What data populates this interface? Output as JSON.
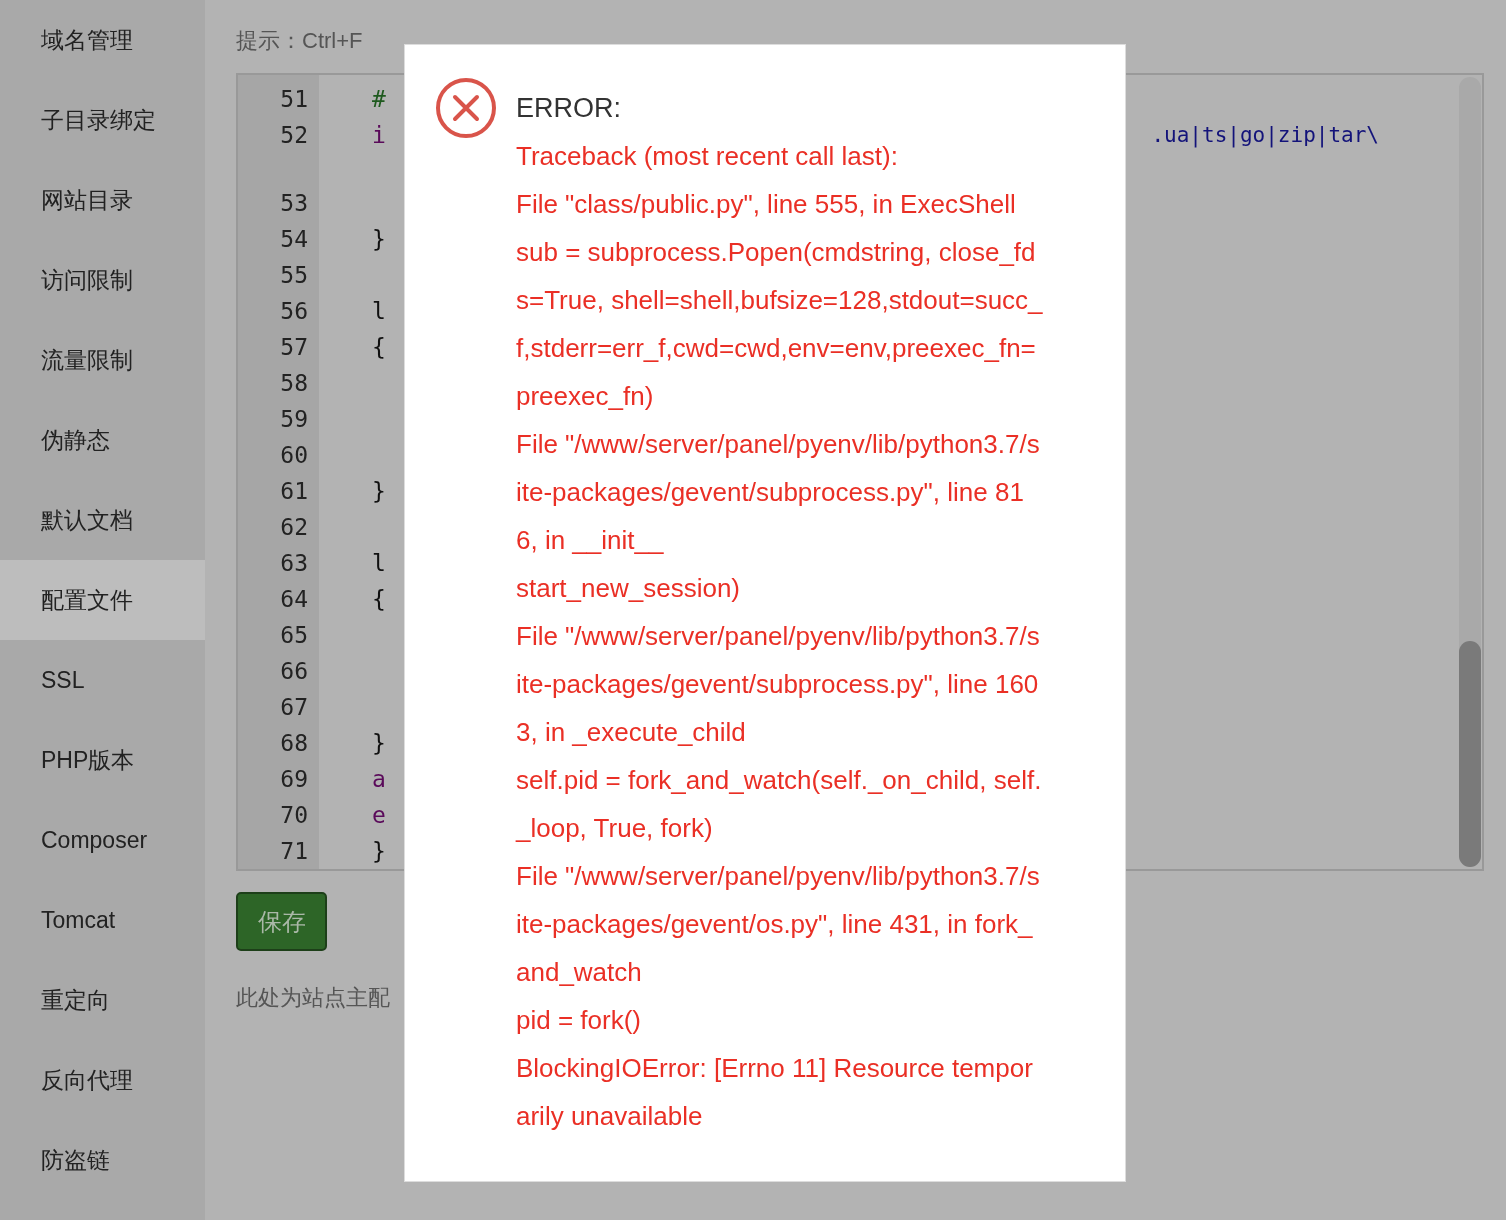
{
  "sidebar": {
    "items": [
      {
        "label": "域名管理",
        "selected": false
      },
      {
        "label": "子目录绑定",
        "selected": false
      },
      {
        "label": "网站目录",
        "selected": false
      },
      {
        "label": "访问限制",
        "selected": false
      },
      {
        "label": "流量限制",
        "selected": false
      },
      {
        "label": "伪静态",
        "selected": false
      },
      {
        "label": "默认文档",
        "selected": false
      },
      {
        "label": "配置文件",
        "selected": true
      },
      {
        "label": "SSL",
        "selected": false
      },
      {
        "label": "PHP版本",
        "selected": false
      },
      {
        "label": "Composer",
        "selected": false
      },
      {
        "label": "Tomcat",
        "selected": false
      },
      {
        "label": "重定向",
        "selected": false
      },
      {
        "label": "反向代理",
        "selected": false
      },
      {
        "label": "防盗链",
        "selected": false
      }
    ]
  },
  "hint": "提示：Ctrl+F",
  "editor": {
    "lines": [
      {
        "number": "51",
        "code": "#",
        "kind": "comment",
        "wrapped": false
      },
      {
        "number": "52",
        "code": "i",
        "kind": "keyword",
        "tail": ".ua|ts|go|zip|tar\\",
        "wrapped": true
      },
      {
        "number": "53",
        "wrapped": false
      },
      {
        "number": "54",
        "code": "}",
        "kind": "plain",
        "wrapped": false
      },
      {
        "number": "55",
        "wrapped": false
      },
      {
        "number": "56",
        "code": "l",
        "kind": "plain",
        "wrapped": false
      },
      {
        "number": "57",
        "code": "{",
        "kind": "plain",
        "wrapped": false
      },
      {
        "number": "58",
        "wrapped": false
      },
      {
        "number": "59",
        "wrapped": false
      },
      {
        "number": "60",
        "wrapped": false
      },
      {
        "number": "61",
        "code": "}",
        "kind": "plain",
        "wrapped": false
      },
      {
        "number": "62",
        "wrapped": false
      },
      {
        "number": "63",
        "code": "l",
        "kind": "plain",
        "wrapped": false
      },
      {
        "number": "64",
        "code": "{",
        "kind": "plain",
        "wrapped": false
      },
      {
        "number": "65",
        "wrapped": false
      },
      {
        "number": "66",
        "wrapped": false
      },
      {
        "number": "67",
        "wrapped": false
      },
      {
        "number": "68",
        "code": "}",
        "kind": "plain",
        "wrapped": false
      },
      {
        "number": "69",
        "code": "a",
        "kind": "keyword",
        "wrapped": false
      },
      {
        "number": "70",
        "code": "e",
        "kind": "keyword",
        "wrapped": false
      },
      {
        "number": "71",
        "code": "}",
        "kind": "plain",
        "wrapped": false
      }
    ]
  },
  "save_button": "保存",
  "note": "此处为站点主配",
  "dialog": {
    "title": "ERROR:",
    "lines": [
      "Traceback (most recent call last):",
      "File \"class/public.py\", line 555, in ExecShell",
      "sub = subprocess.Popen(cmdstring, close_fd",
      "s=True, shell=shell,bufsize=128,stdout=succ_",
      "f,stderr=err_f,cwd=cwd,env=env,preexec_fn=",
      "preexec_fn)",
      "File \"/www/server/panel/pyenv/lib/python3.7/s",
      "ite-packages/gevent/subprocess.py\", line 81",
      "6, in __init__",
      "start_new_session)",
      "File \"/www/server/panel/pyenv/lib/python3.7/s",
      "ite-packages/gevent/subprocess.py\", line 160",
      "3, in _execute_child",
      "self.pid = fork_and_watch(self._on_child, self.",
      "_loop, True, fork)",
      "File \"/www/server/panel/pyenv/lib/python3.7/s",
      "ite-packages/gevent/os.py\", line 431, in fork_",
      "and_watch",
      "pid = fork()",
      "BlockingIOError: [Errno 11] Resource tempor",
      "arily unavailable"
    ]
  }
}
